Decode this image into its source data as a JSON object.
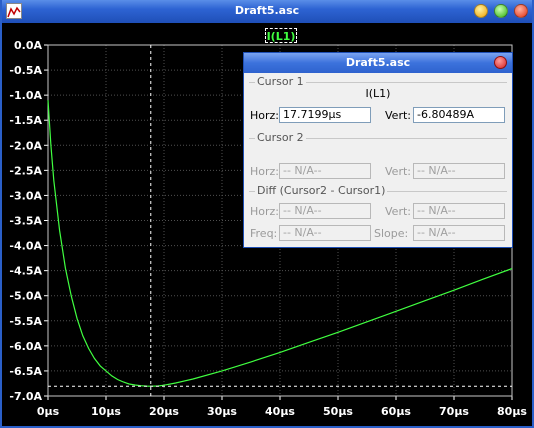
{
  "window": {
    "title": "Draft5.asc"
  },
  "trace_label": "I(L1)",
  "colors": {
    "trace": "#40ff40",
    "background": "#000000",
    "grid": "#505050",
    "titlebar": "#2d63d2"
  },
  "chart_data": {
    "type": "line",
    "x_ticks": [
      "0µs",
      "10µs",
      "20µs",
      "30µs",
      "40µs",
      "50µs",
      "60µs",
      "70µs",
      "80µs"
    ],
    "y_ticks": [
      "0.0A",
      "-0.5A",
      "-1.0A",
      "-1.5A",
      "-2.0A",
      "-2.5A",
      "-3.0A",
      "-3.5A",
      "-4.0A",
      "-4.5A",
      "-5.0A",
      "-5.5A",
      "-6.0A",
      "-6.5A",
      "-7.0A"
    ],
    "xlim": [
      0,
      80
    ],
    "ylim": [
      -7.0,
      0.0
    ],
    "grid": true,
    "series": [
      {
        "name": "I(L1)",
        "x": [
          0,
          0.5,
          1,
          2,
          3,
          4,
          5,
          6,
          7,
          8,
          9,
          10,
          11,
          12,
          13,
          14,
          15,
          16,
          17,
          17.72,
          19,
          20,
          22,
          25,
          30,
          35,
          40,
          45,
          50,
          55,
          60,
          65,
          70,
          75,
          80
        ],
        "y": [
          -1.1,
          -2.0,
          -2.7,
          -3.7,
          -4.45,
          -5.0,
          -5.45,
          -5.8,
          -6.05,
          -6.25,
          -6.4,
          -6.5,
          -6.6,
          -6.67,
          -6.72,
          -6.76,
          -6.78,
          -6.795,
          -6.803,
          -6.805,
          -6.8,
          -6.785,
          -6.74,
          -6.66,
          -6.5,
          -6.32,
          -6.13,
          -5.93,
          -5.73,
          -5.52,
          -5.31,
          -5.1,
          -4.89,
          -4.67,
          -4.46
        ]
      }
    ],
    "cursor": {
      "x": 17.7199,
      "y": -6.80489
    }
  },
  "cursor_dialog": {
    "title": "Draft5.asc",
    "cursor1": {
      "group_label": "Cursor 1",
      "trace": "I(L1)",
      "horz_label": "Horz:",
      "horz_value": "17.7199µs",
      "vert_label": "Vert:",
      "vert_value": "-6.80489A"
    },
    "cursor2": {
      "group_label": "Cursor 2",
      "horz_label": "Horz:",
      "horz_value": "-- N/A--",
      "vert_label": "Vert:",
      "vert_value": "-- N/A--"
    },
    "diff": {
      "group_label": "Diff (Cursor2 - Cursor1)",
      "horz_label": "Horz:",
      "horz_value": "-- N/A--",
      "vert_label": "Vert:",
      "vert_value": "-- N/A--",
      "freq_label": "Freq:",
      "freq_value": "-- N/A--",
      "slope_label": "Slope:",
      "slope_value": "-- N/A--"
    }
  },
  "icons": {
    "app": "waveform-icon",
    "minimize": "minimize-icon",
    "maximize": "maximize-icon",
    "close": "close-icon",
    "dialog_close": "close-icon"
  }
}
